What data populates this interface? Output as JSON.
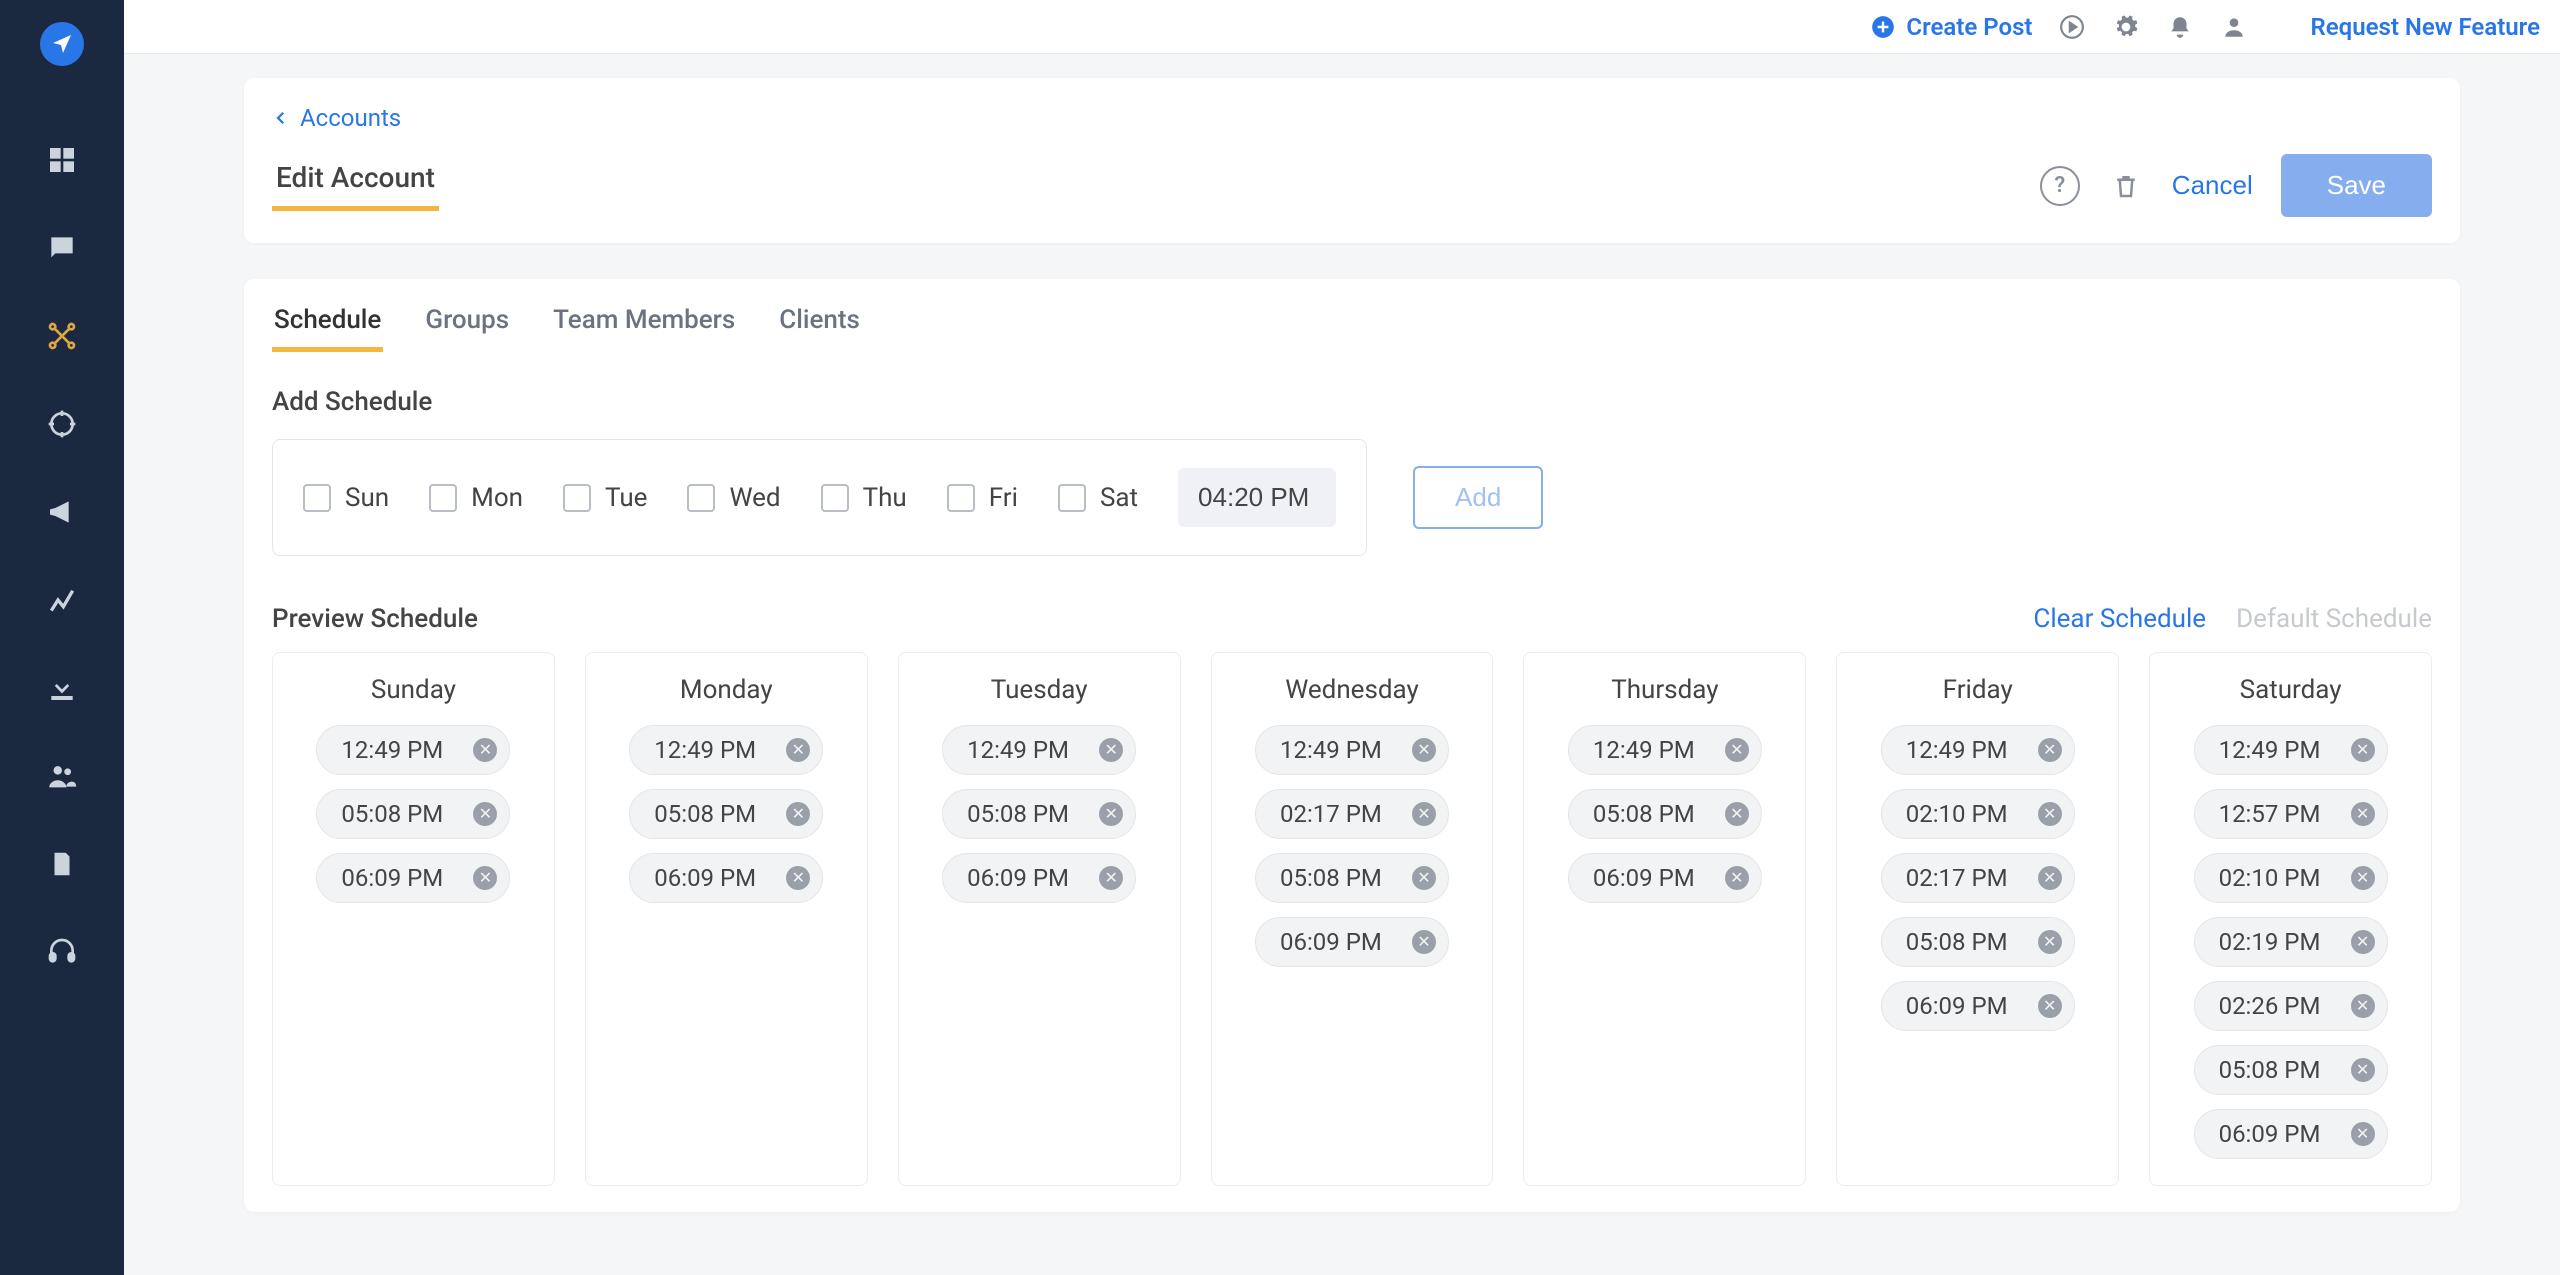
{
  "topbar": {
    "create_label": "Create Post",
    "request_label": "Request New Feature"
  },
  "breadcrumb": {
    "label": "Accounts"
  },
  "header": {
    "title": "Edit Account",
    "cancel_label": "Cancel",
    "save_label": "Save"
  },
  "tabs": [
    {
      "id": "schedule",
      "label": "Schedule",
      "active": true
    },
    {
      "id": "groups",
      "label": "Groups",
      "active": false
    },
    {
      "id": "team-members",
      "label": "Team Members",
      "active": false
    },
    {
      "id": "clients",
      "label": "Clients",
      "active": false
    }
  ],
  "add_section": {
    "title": "Add Schedule",
    "days": [
      {
        "key": "sun",
        "label": "Sun"
      },
      {
        "key": "mon",
        "label": "Mon"
      },
      {
        "key": "tue",
        "label": "Tue"
      },
      {
        "key": "wed",
        "label": "Wed"
      },
      {
        "key": "thu",
        "label": "Thu"
      },
      {
        "key": "fri",
        "label": "Fri"
      },
      {
        "key": "sat",
        "label": "Sat"
      }
    ],
    "time_value": "04:20 PM",
    "add_btn_label": "Add"
  },
  "preview": {
    "title": "Preview Schedule",
    "clear_label": "Clear Schedule",
    "default_label": "Default Schedule",
    "days": [
      {
        "name": "Sunday",
        "times": [
          "12:49 PM",
          "05:08 PM",
          "06:09 PM"
        ]
      },
      {
        "name": "Monday",
        "times": [
          "12:49 PM",
          "05:08 PM",
          "06:09 PM"
        ]
      },
      {
        "name": "Tuesday",
        "times": [
          "12:49 PM",
          "05:08 PM",
          "06:09 PM"
        ]
      },
      {
        "name": "Wednesday",
        "times": [
          "12:49 PM",
          "02:17 PM",
          "05:08 PM",
          "06:09 PM"
        ]
      },
      {
        "name": "Thursday",
        "times": [
          "12:49 PM",
          "05:08 PM",
          "06:09 PM"
        ]
      },
      {
        "name": "Friday",
        "times": [
          "12:49 PM",
          "02:10 PM",
          "02:17 PM",
          "05:08 PM",
          "06:09 PM"
        ]
      },
      {
        "name": "Saturday",
        "times": [
          "12:49 PM",
          "12:57 PM",
          "02:10 PM",
          "02:19 PM",
          "02:26 PM",
          "05:08 PM",
          "06:09 PM"
        ]
      }
    ]
  },
  "sidebar": {
    "items": [
      "dashboard-icon",
      "messages-icon",
      "network-icon",
      "target-icon",
      "megaphone-icon",
      "analytics-icon",
      "download-icon",
      "people-icon",
      "document-icon",
      "support-icon"
    ]
  }
}
